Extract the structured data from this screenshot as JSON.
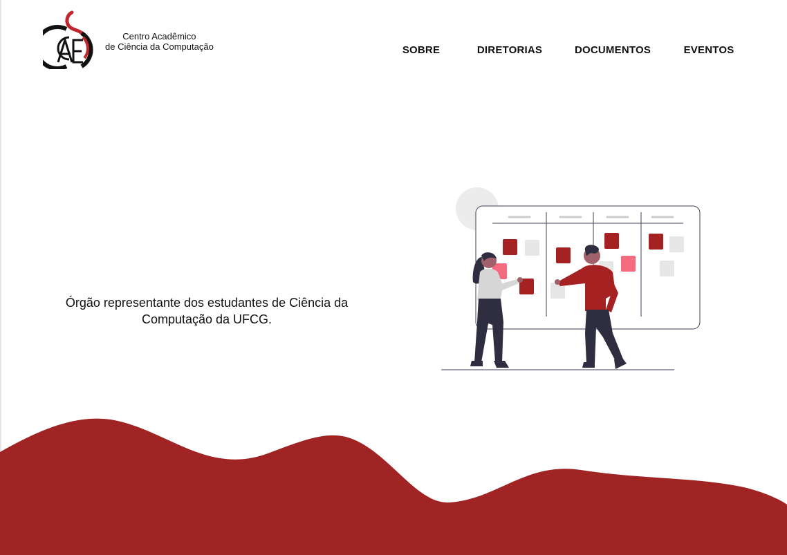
{
  "brand": {
    "line1": "Centro Acadêmico",
    "line2": "de Ciência da Computação",
    "logo_icon": "caccc-logo-icon",
    "colors": {
      "red": "#c0272d",
      "black": "#111111"
    }
  },
  "nav": {
    "items": [
      {
        "label": "SOBRE"
      },
      {
        "label": "DIRETORIAS"
      },
      {
        "label": "DOCUMENTOS"
      },
      {
        "label": "EVENTOS"
      }
    ]
  },
  "hero": {
    "tagline": "Órgão representante dos estudantes de Ciência da Computação da UFCG.",
    "illustration_icon": "kanban-board-team-illustration-icon"
  },
  "colors": {
    "accent": "#a02424",
    "note_dark": "#a62222",
    "note_pink": "#f46b7f",
    "note_gray": "#e6e6e6",
    "figure_dark": "#2f2e41"
  }
}
